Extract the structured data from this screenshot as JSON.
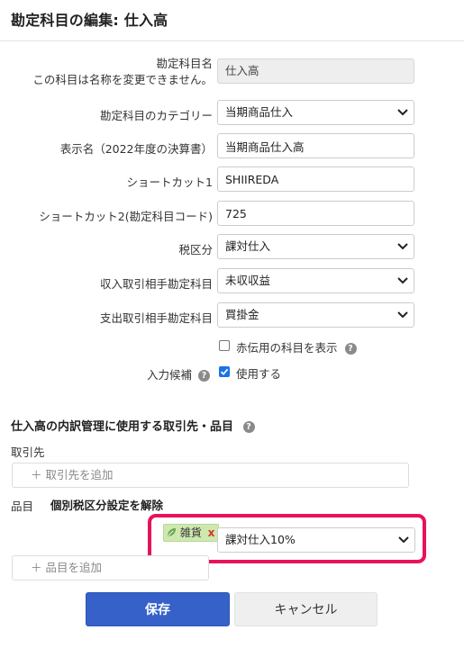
{
  "header": {
    "title": "勘定科目の編集: 仕入高"
  },
  "form": {
    "account_name": {
      "label": "勘定科目名",
      "note": "この科目は名称を変更できません。",
      "value": "仕入高"
    },
    "category": {
      "label": "勘定科目のカテゴリー",
      "value": "当期商品仕入"
    },
    "display_name": {
      "label": "表示名（2022年度の決算書）",
      "value": "当期商品仕入高"
    },
    "shortcut1": {
      "label": "ショートカット1",
      "value": "SHIIREDA"
    },
    "shortcut2": {
      "label": "ショートカット2(勘定科目コード)",
      "value": "725"
    },
    "tax_category": {
      "label": "税区分",
      "value": "課対仕入"
    },
    "income_counter": {
      "label": "収入取引相手勘定科目",
      "value": "未収収益"
    },
    "expense_counter": {
      "label": "支出取引相手勘定科目",
      "value": "買掛金"
    },
    "red_entry": {
      "label": "赤伝用の科目を表示",
      "checked": false
    },
    "input_candidate": {
      "label": "入力候補",
      "option": "使用する",
      "checked": true
    }
  },
  "breakdown": {
    "title": "仕入高の内訳管理に使用する取引先・品目",
    "partners_label": "取引先",
    "add_partner": "＋ 取引先を追加",
    "items_label": "品目",
    "tax_release_link": "個別税区分設定を解除",
    "tag": {
      "label": "雑貨",
      "remove": "x"
    },
    "tag_tax_value": "課対仕入10%",
    "add_item": "＋ 品目を追加"
  },
  "buttons": {
    "save": "保存",
    "cancel": "キャンセル"
  },
  "colors": {
    "primary": "#3661c9",
    "highlight": "#e8125c",
    "tag_bg": "#cfe8b0",
    "checkbox": "#1a73e8"
  }
}
